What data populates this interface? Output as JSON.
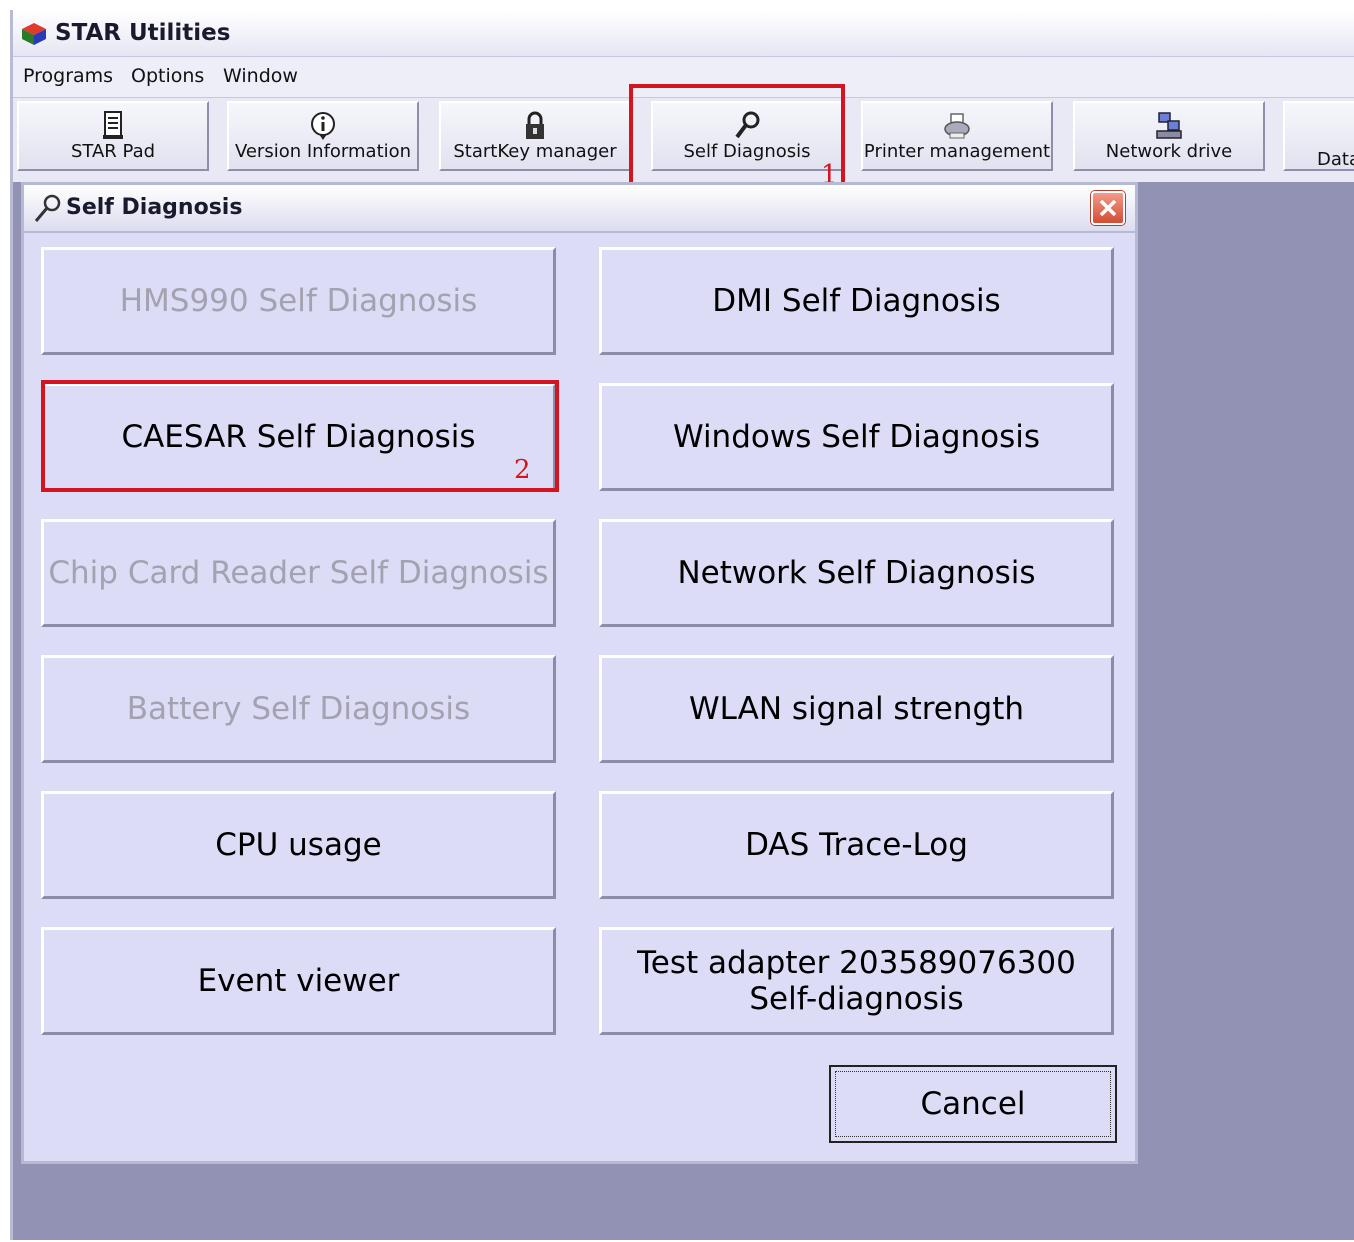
{
  "app": {
    "title": "STAR Utilities"
  },
  "menu": [
    "Programs",
    "Options",
    "Window"
  ],
  "toolbar": [
    {
      "label": "STAR Pad",
      "icon": "document-icon"
    },
    {
      "label": "Version Information",
      "icon": "info-icon"
    },
    {
      "label": "StartKey manager",
      "icon": "lock-icon"
    },
    {
      "label": "Self Diagnosis",
      "icon": "wrench-icon"
    },
    {
      "label": "Printer management",
      "icon": "printer-icon"
    },
    {
      "label": "Network drive",
      "icon": "network-drive-icon"
    },
    {
      "label": "Data",
      "icon": "data-icon"
    }
  ],
  "annotations": {
    "step1": "1",
    "step2": "2",
    "color": "#d4141e"
  },
  "dialog": {
    "title": "Self Diagnosis",
    "buttons": [
      {
        "label": "HMS990 Self Diagnosis",
        "enabled": false
      },
      {
        "label": "DMI Self Diagnosis",
        "enabled": true
      },
      {
        "label": "CAESAR Self Diagnosis",
        "enabled": true
      },
      {
        "label": "Windows Self Diagnosis",
        "enabled": true
      },
      {
        "label": "Chip Card Reader Self Diagnosis",
        "enabled": false
      },
      {
        "label": "Network Self Diagnosis",
        "enabled": true
      },
      {
        "label": "Battery Self Diagnosis",
        "enabled": false
      },
      {
        "label": "WLAN signal strength",
        "enabled": true
      },
      {
        "label": "CPU usage",
        "enabled": true
      },
      {
        "label": "DAS Trace-Log",
        "enabled": true
      },
      {
        "label": "Event viewer",
        "enabled": true
      },
      {
        "label": "Test adapter 203589076300 Self-diagnosis",
        "enabled": true
      }
    ],
    "cancel": "Cancel"
  }
}
